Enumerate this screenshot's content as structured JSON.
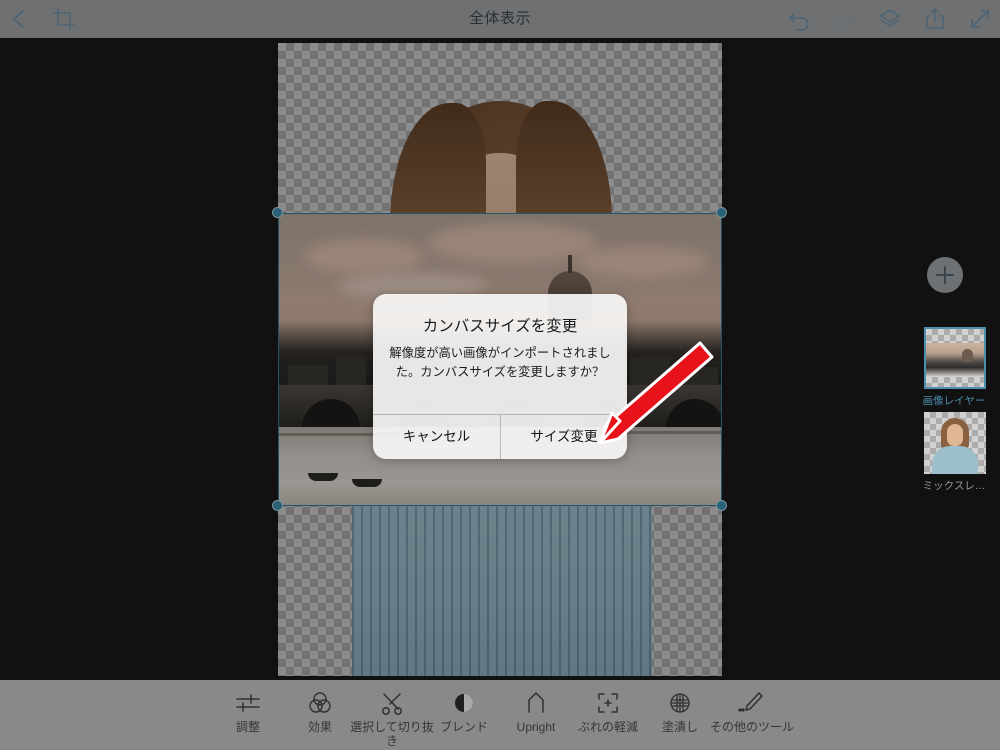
{
  "topbar": {
    "title": "全体表示",
    "back_icon": "back-chevron-icon",
    "crop_icon": "crop-icon",
    "undo_icon": "undo-icon",
    "redo_icon": "redo-icon",
    "layers_icon": "layers-icon",
    "share_icon": "share-icon",
    "fullscreen_icon": "fullscreen-icon",
    "accent_color": "#4a6475",
    "background_color": "#6e7072"
  },
  "layer_panel": {
    "add_button_label": "+",
    "add_button_name": "add-layer-button",
    "layers": [
      {
        "label": "画像レイヤー",
        "selected": true,
        "thumbnail": "city-bridge-photo"
      },
      {
        "label": "ミックスレ…",
        "selected": false,
        "thumbnail": "woman-blue-sweater-photo"
      }
    ],
    "selected_color": "#4d8fae",
    "unselected_color": "#9a9a9a"
  },
  "canvas": {
    "background": "transparent-checkerboard",
    "base_layer": "woman-blue-sweater-photo",
    "pasted_layer": "city-bridge-photo",
    "selection_handles": 4,
    "selection_color": "#2f7fa3"
  },
  "dialog": {
    "title": "カンバスサイズを変更",
    "message": "解像度が高い画像がインポートされました。カンバスサイズを変更しますか？",
    "cancel_label": "キャンセル",
    "confirm_label": "サイズ変更"
  },
  "annotation": {
    "arrow_color": "#e8131a",
    "arrow_outline": "#ffffff",
    "points_to": "サイズ変更"
  },
  "toolbar": {
    "items": [
      {
        "label": "調整",
        "icon": "adjust-sliders-icon"
      },
      {
        "label": "効果",
        "icon": "effects-venn-icon"
      },
      {
        "label": "選択して切り抜き",
        "icon": "scissors-icon"
      },
      {
        "label": "ブレンド",
        "icon": "blend-circle-icon"
      },
      {
        "label": "Upright",
        "icon": "upright-arrow-icon"
      },
      {
        "label": "ぶれの軽減",
        "icon": "deblur-brackets-icon"
      },
      {
        "label": "塗潰し",
        "icon": "fill-sphere-icon"
      },
      {
        "label": "その他のツール",
        "icon": "pencil-more-tools-icon"
      }
    ],
    "background_color": "#89898a"
  }
}
